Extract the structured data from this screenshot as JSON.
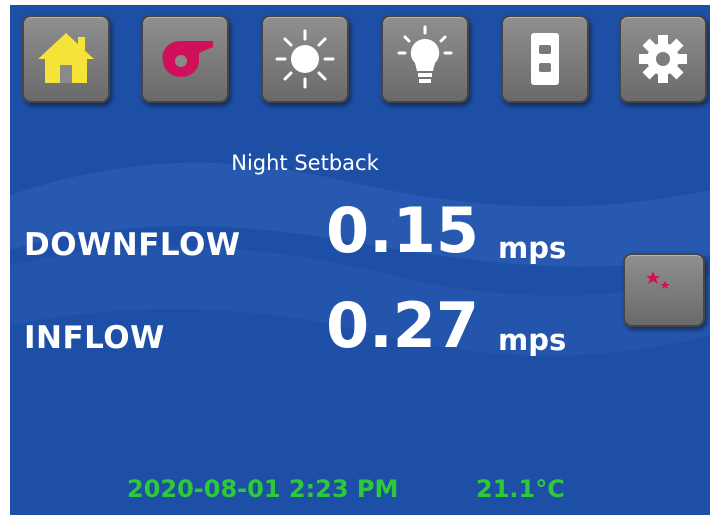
{
  "toolbar": {
    "buttons": [
      {
        "name": "home",
        "icon": "home-icon",
        "icon_color": "#f5e33a"
      },
      {
        "name": "fan",
        "icon": "fan-blower-icon",
        "icon_color": "#d0105a"
      },
      {
        "name": "sun",
        "icon": "sun-icon",
        "icon_color": "#ffffff"
      },
      {
        "name": "light",
        "icon": "light-bulb-icon",
        "icon_color": "#ffffff"
      },
      {
        "name": "outlet",
        "icon": "power-outlet-icon",
        "icon_color": "#ffffff"
      },
      {
        "name": "settings",
        "icon": "gear-icon",
        "icon_color": "#ffffff"
      }
    ]
  },
  "mode": {
    "label": "Night Setback"
  },
  "measurements": {
    "downflow": {
      "label": "DOWNFLOW",
      "value": "0.15",
      "unit": "mps"
    },
    "inflow": {
      "label": "INFLOW",
      "value": "0.27",
      "unit": "mps"
    }
  },
  "night_button": {
    "icon": "moon-stars-icon",
    "icon_color": "#d0105a"
  },
  "status": {
    "datetime": "2020-08-01 2:23 PM",
    "temperature": "21.1°C",
    "color": "#2fc83a"
  },
  "colors": {
    "background": "#1e4fa6",
    "button": "#7d7d7d"
  }
}
